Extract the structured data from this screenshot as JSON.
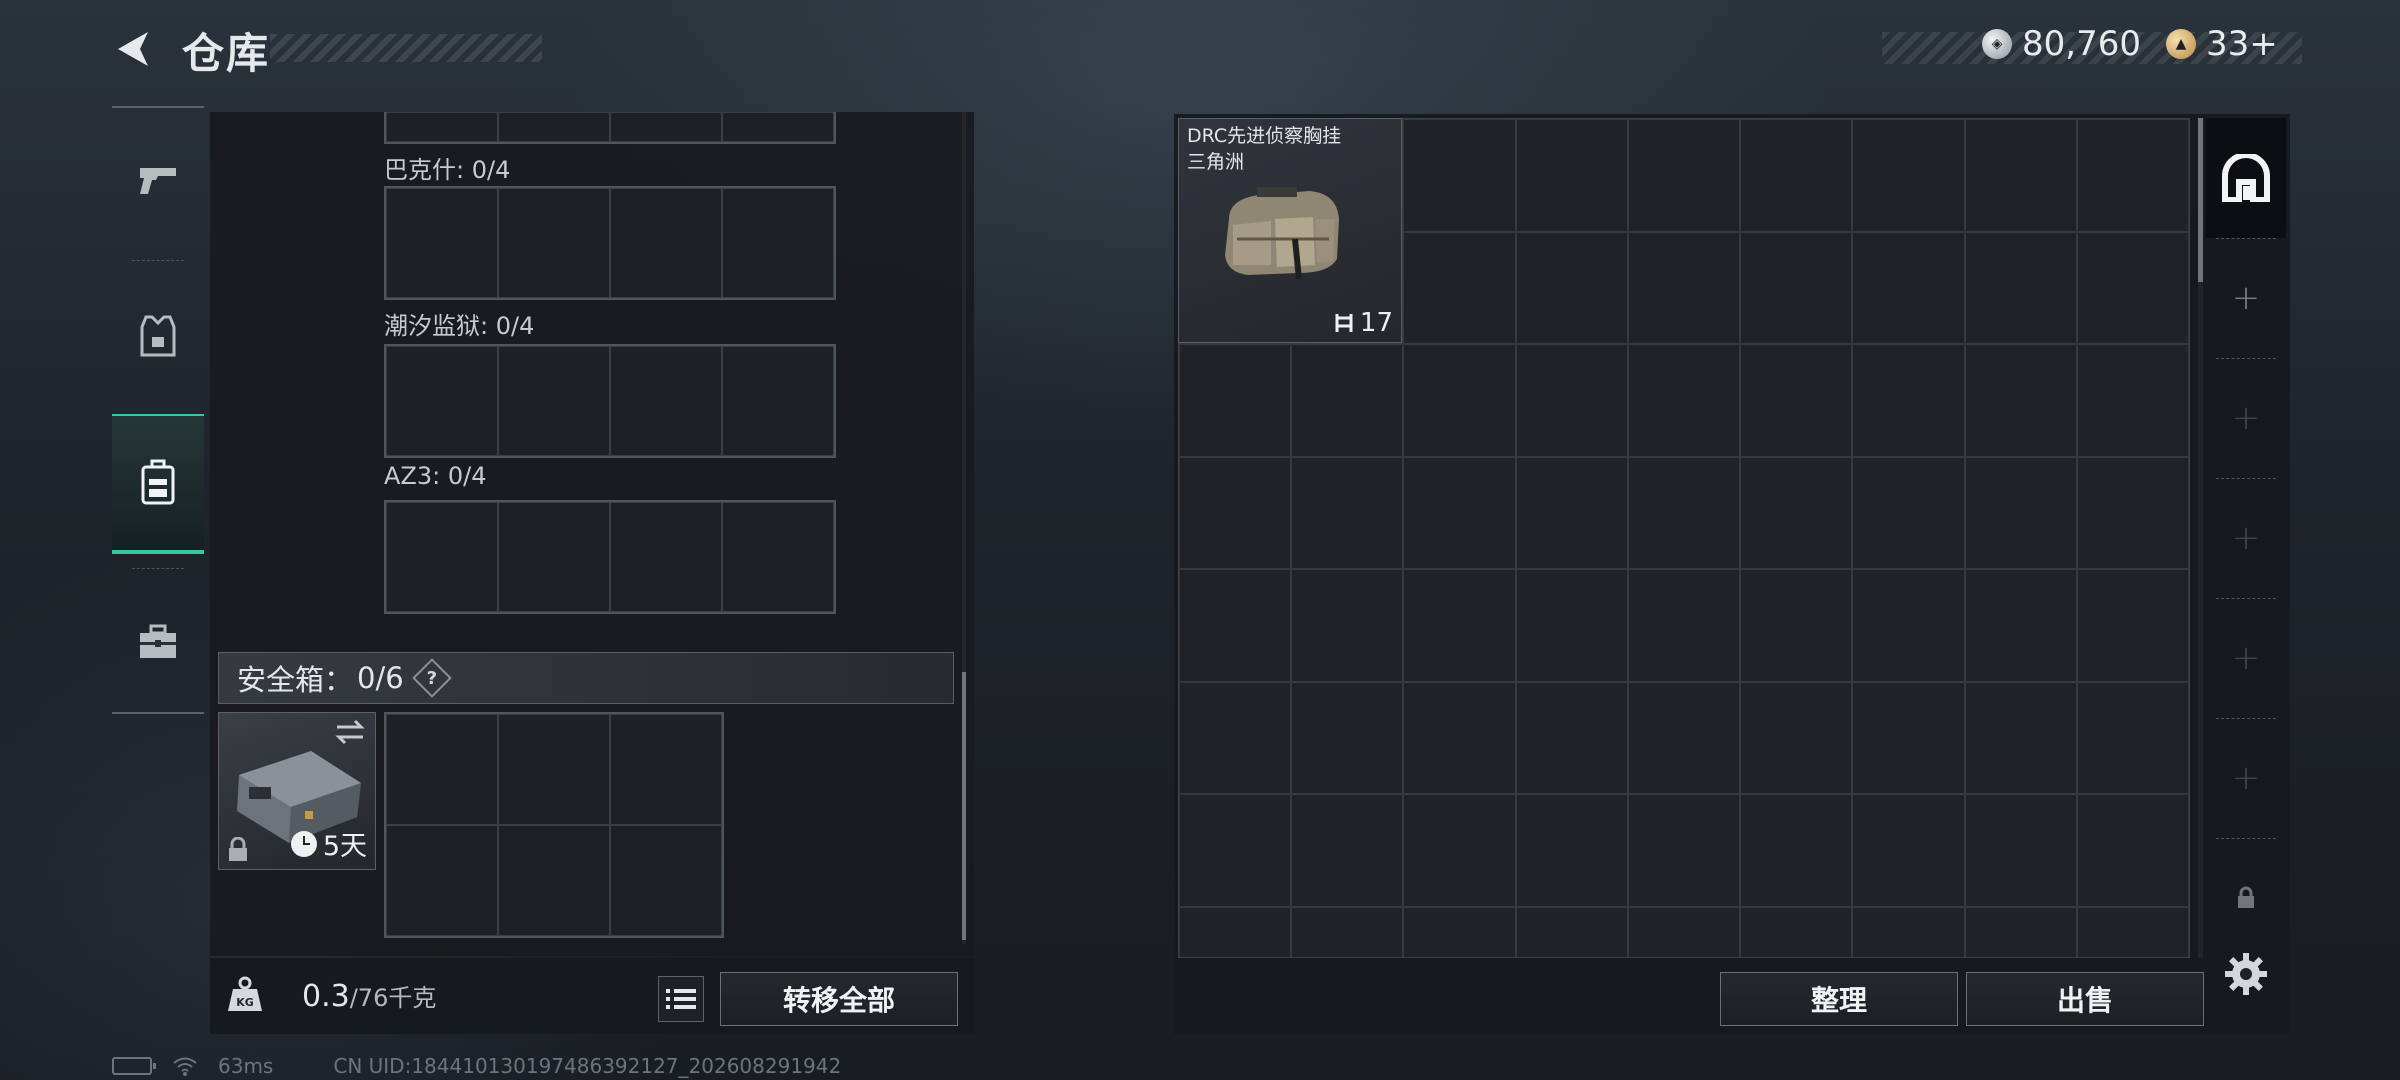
{
  "header": {
    "title": "仓库",
    "currency": [
      {
        "name": "silver-coin-icon",
        "value": "80,760"
      },
      {
        "name": "gold-coin-icon",
        "value": "33+"
      }
    ]
  },
  "left_nav": {
    "items": [
      {
        "name": "nav-weapons",
        "icon": "pistol-icon"
      },
      {
        "name": "nav-armor",
        "icon": "vest-icon"
      },
      {
        "name": "nav-containers",
        "icon": "backpack-icon",
        "active": true
      },
      {
        "name": "nav-briefcase",
        "icon": "briefcase-icon"
      }
    ]
  },
  "keychain": {
    "slots": [
      {
        "label": "巴克什: 0/4"
      },
      {
        "label": "潮汐监狱: 0/4"
      },
      {
        "label": "AZ3: 0/4"
      }
    ]
  },
  "safebox": {
    "label": "安全箱：",
    "count": "0/6",
    "help": "?",
    "timer": "5天"
  },
  "footer_left": {
    "weight_value": "0.3",
    "weight_unit": "/76千克",
    "transfer_all": "转移全部"
  },
  "stash": {
    "item": {
      "name": "DRC先进侦察胸挂",
      "tag": "三角洲",
      "stat": "17"
    },
    "sort_button": "整理",
    "sell_button": "出售"
  },
  "side_tabs": {
    "icons": [
      "stash-main-icon",
      "add-icon",
      "add-icon",
      "add-icon",
      "add-icon",
      "add-icon",
      "lock-icon"
    ]
  },
  "status_bar": {
    "ping": "63ms",
    "uid": "CN UID:18441013019748639212­7_202608291942"
  }
}
